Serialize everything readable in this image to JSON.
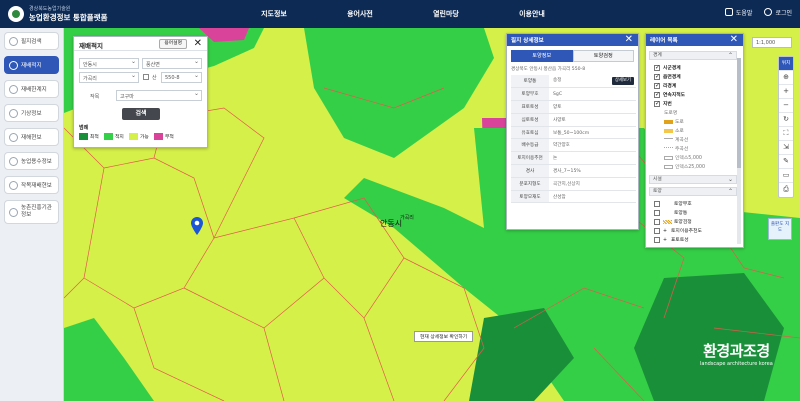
{
  "header": {
    "org": "경상북도농업기술원",
    "title": "농업환경정보 통합플랫폼",
    "nav": [
      "지도정보",
      "용어사전",
      "열린마당",
      "이용안내"
    ],
    "right": [
      "도움말",
      "로그인"
    ]
  },
  "sidebar": {
    "items": [
      {
        "label": "필지검색",
        "active": false
      },
      {
        "label": "재배적지",
        "active": true
      },
      {
        "label": "재배한계지",
        "active": false
      },
      {
        "label": "기상정보",
        "active": false
      },
      {
        "label": "재해현보",
        "active": false
      },
      {
        "label": "농업용수정보",
        "active": false
      },
      {
        "label": "작목재배현보",
        "active": false
      },
      {
        "label": "농촌진흥기관 정보",
        "active": false
      }
    ]
  },
  "filter_panel": {
    "title": "재배적지",
    "mini_button": "용어설명",
    "province": "안동시",
    "town": "풍산면",
    "village": "가곡리",
    "mountain_label": "산",
    "lot_number": "550-8",
    "crop_label": "작목",
    "crop_value": "고구마",
    "search_button": "검색",
    "legend_title": "범례",
    "legend": [
      {
        "label": "최적",
        "color": "#1a8f3a"
      },
      {
        "label": "적지",
        "color": "#35d04a"
      },
      {
        "label": "가능",
        "color": "#d6f04a"
      },
      {
        "label": "부적",
        "color": "#d9449a"
      }
    ]
  },
  "info_panel": {
    "title": "필지 상세정보",
    "tabs": [
      "토양정보",
      "토양검정"
    ],
    "address": "경상북도 안동시 풍산읍 가곡리 550-8",
    "detail_button": "상세보기",
    "rows": [
      {
        "k": "토양통",
        "v": "송정"
      },
      {
        "k": "토양부호",
        "v": "SgC"
      },
      {
        "k": "표토토성",
        "v": "양토"
      },
      {
        "k": "심토토성",
        "v": "사양토"
      },
      {
        "k": "유효토심",
        "v": "보통_50~100cm"
      },
      {
        "k": "배수등급",
        "v": "약간양호"
      },
      {
        "k": "토지이용추천",
        "v": "논"
      },
      {
        "k": "경사",
        "v": "경사_7~15%"
      },
      {
        "k": "분포지형도",
        "v": "곡간지,선상지"
      },
      {
        "k": "토양모재도",
        "v": "산성암"
      }
    ]
  },
  "layer_panel": {
    "title": "레이어 목록",
    "group1": "경계",
    "group1_items": [
      {
        "label": "시군경계",
        "checked": true,
        "bold": true
      },
      {
        "label": "읍면경계",
        "checked": true,
        "bold": true
      },
      {
        "label": "리경계",
        "checked": true,
        "bold": true
      },
      {
        "label": "연속지적도",
        "checked": true,
        "bold": true
      },
      {
        "label": "지번",
        "checked": true,
        "bold": true
      },
      {
        "label": "도로명",
        "checked": false,
        "bold": false
      },
      {
        "label": "도로",
        "checked": false,
        "bold": false,
        "swatch": "#e0a21b"
      },
      {
        "label": "소로",
        "checked": false,
        "bold": false,
        "swatch": "#f4c74a"
      },
      {
        "label": "계곡선",
        "checked": false,
        "bold": false
      },
      {
        "label": "주곡선",
        "checked": false,
        "bold": false
      },
      {
        "label": "인덱스5,000",
        "checked": false,
        "bold": false
      },
      {
        "label": "인덱스25,000",
        "checked": false,
        "bold": false
      }
    ],
    "group2": "시설",
    "group3": "토양",
    "group3_items": [
      {
        "label": "토양부호",
        "checked": false
      },
      {
        "label": "토양통",
        "checked": false
      },
      {
        "label": "토양검정",
        "checked": false
      },
      {
        "label": "토지이용추천도",
        "checked": false
      },
      {
        "label": "표토토성",
        "checked": false
      }
    ]
  },
  "tools": {
    "scale": "1:1,000",
    "mini_map": "출판도 지도",
    "items": [
      "위치",
      "⊕",
      "+",
      "−",
      "↻",
      "⛶",
      "⇲",
      "✎",
      "▭",
      "⎙"
    ]
  },
  "map": {
    "place_label": "안동시",
    "sub_label": "가곡리",
    "guide_button": "현재 상세정보 확인하기"
  },
  "watermark": {
    "title": "환경과조경",
    "subtitle": "landscape architecture korea"
  }
}
